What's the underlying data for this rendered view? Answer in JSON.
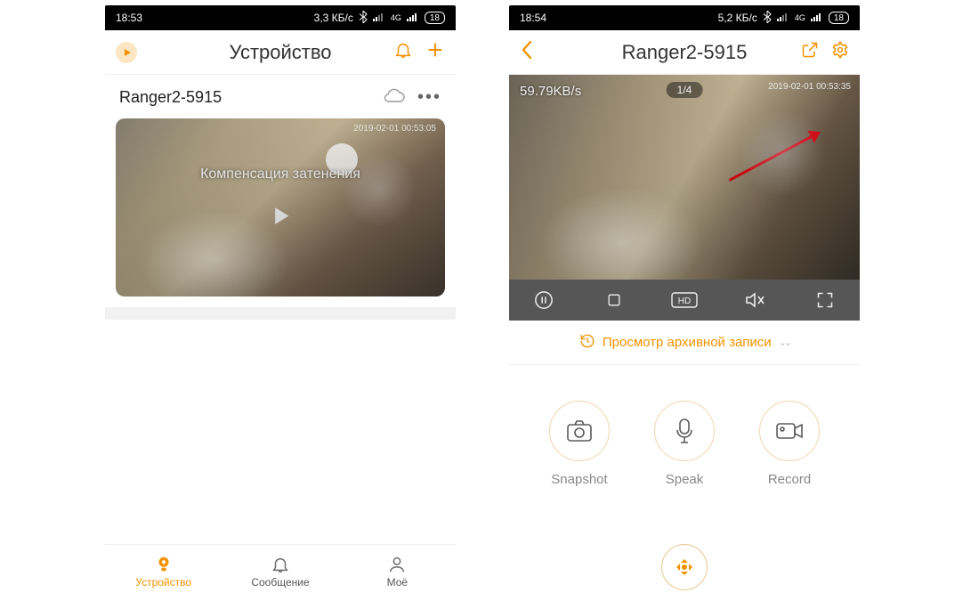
{
  "left": {
    "statusbar": {
      "time": "18:53",
      "speed": "3,3 КБ/c",
      "net": "4G",
      "battery": "18"
    },
    "header": {
      "title": "Устройство"
    },
    "device": {
      "name": "Ranger2-5915"
    },
    "thumb": {
      "overlay": "Компенсация затенения",
      "timestamp": "2019-02-01 00:53:05"
    },
    "nav": {
      "device": "Устройство",
      "message": "Сообщение",
      "me": "Моё"
    }
  },
  "right": {
    "statusbar": {
      "time": "18:54",
      "speed": "5,2 КБ/c",
      "net": "4G",
      "battery": "18"
    },
    "header": {
      "title": "Ranger2-5915"
    },
    "live": {
      "kbps": "59.79KB/s",
      "pager": "1/4",
      "timestamp": "2019-02-01 00:53:35"
    },
    "archive": "Просмотр архивной записи",
    "actions": {
      "snapshot": "Snapshot",
      "speak": "Speak",
      "record": "Record"
    }
  }
}
